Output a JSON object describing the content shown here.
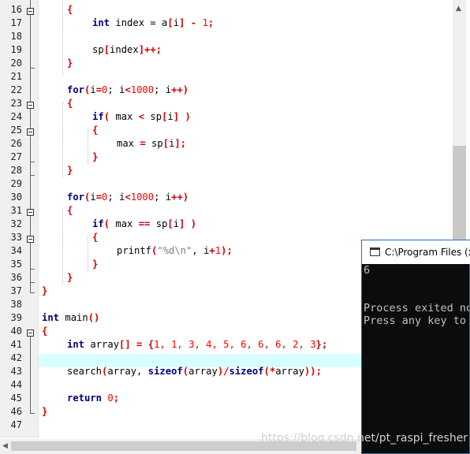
{
  "editor": {
    "line_numbers": [
      "16",
      "17",
      "18",
      "19",
      "20",
      "21",
      "22",
      "23",
      "24",
      "25",
      "26",
      "27",
      "28",
      "29",
      "30",
      "31",
      "32",
      "33",
      "34",
      "35",
      "36",
      "37",
      "38",
      "39",
      "40",
      "41",
      "42",
      "43",
      "44",
      "45",
      "46",
      "47"
    ],
    "lines": {
      "l16": "{",
      "l17_kw": "int",
      "l17_rest": " index = a",
      "l17_b1": "[",
      "l17_i": "i",
      "l17_b2": "]",
      "l17_minus": " - ",
      "l17_num": "1",
      "l17_semi": ";",
      "l19_a": "sp",
      "l19_b": "[",
      "l19_c": "index",
      "l19_d": "]++;",
      "l20": "}",
      "l22_kw": "for",
      "l22_p": "(",
      "l22_i": "i",
      "l22_eq": "=",
      "l22_n0": "0",
      "l22_s1": "; i",
      "l22_lt": "<",
      "l22_n1": "1000",
      "l22_s2": "; i",
      "l22_pp": "++)",
      "l23": "{",
      "l24_kw": "if",
      "l24_p": "(",
      "l24_a": " max ",
      "l24_lt": "<",
      "l24_b": " sp",
      "l24_c": "[",
      "l24_d": "i",
      "l24_e": "]",
      "l24_f": " )",
      "l25": "{",
      "l26_a": "max ",
      "l26_eq": "=",
      "l26_b": " sp",
      "l26_c": "[",
      "l26_d": "i",
      "l26_e": "];",
      "l27": "}",
      "l28": "}",
      "l30_kw": "for",
      "l30_p": "(",
      "l30_i": "i",
      "l30_eq": "=",
      "l30_n0": "0",
      "l30_s1": "; i",
      "l30_lt": "<",
      "l30_n1": "1000",
      "l30_s2": "; i",
      "l30_pp": "++)",
      "l31": "{",
      "l32_kw": "if",
      "l32_p": "(",
      "l32_a": " max ",
      "l32_eq": "==",
      "l32_b": " sp",
      "l32_c": "[",
      "l32_d": "i",
      "l32_e": "]",
      "l32_f": " )",
      "l33": "{",
      "l34_a": "printf",
      "l34_p": "(",
      "l34_str": "\"%d\\n\"",
      "l34_c": ", i",
      "l34_pl": "+",
      "l34_n": "1",
      "l34_e": ");",
      "l35": "}",
      "l36": "}",
      "l37": "}",
      "l39_kw": "int",
      "l39_b": " main",
      "l39_p": "()",
      "l40": "{",
      "l41_kw": "int",
      "l41_b": " array",
      "l41_c": "[] = {",
      "l41_nums": "1, 1, 3, 4, 5, 6, 6, 6, 2, 3",
      "l41_e": "};",
      "l43_a": "search",
      "l43_p": "(",
      "l43_b": "array, ",
      "l43_kw1": "sizeof",
      "l43_c": "(",
      "l43_d": "array",
      "l43_e": ")/",
      "l43_kw2": "sizeof",
      "l43_f": "(*",
      "l43_g": "array",
      "l43_h": "));",
      "l45_kw": "return",
      "l45_sp": " ",
      "l45_n": "0",
      "l45_e": ";",
      "l46": "}"
    }
  },
  "console": {
    "title": "C:\\Program Files (x",
    "output_value": "6",
    "exit_line": "Process exited no",
    "press_line": "Press any key to"
  },
  "watermark": "https://blog.csdn.net/pt_raspi_fresher",
  "colors": {
    "keyword": "#000080",
    "operator": "#d40000",
    "number": "#ff0000",
    "string": "#808080",
    "current_line": "#d8ffff",
    "console_bg": "#0c0c0c"
  }
}
